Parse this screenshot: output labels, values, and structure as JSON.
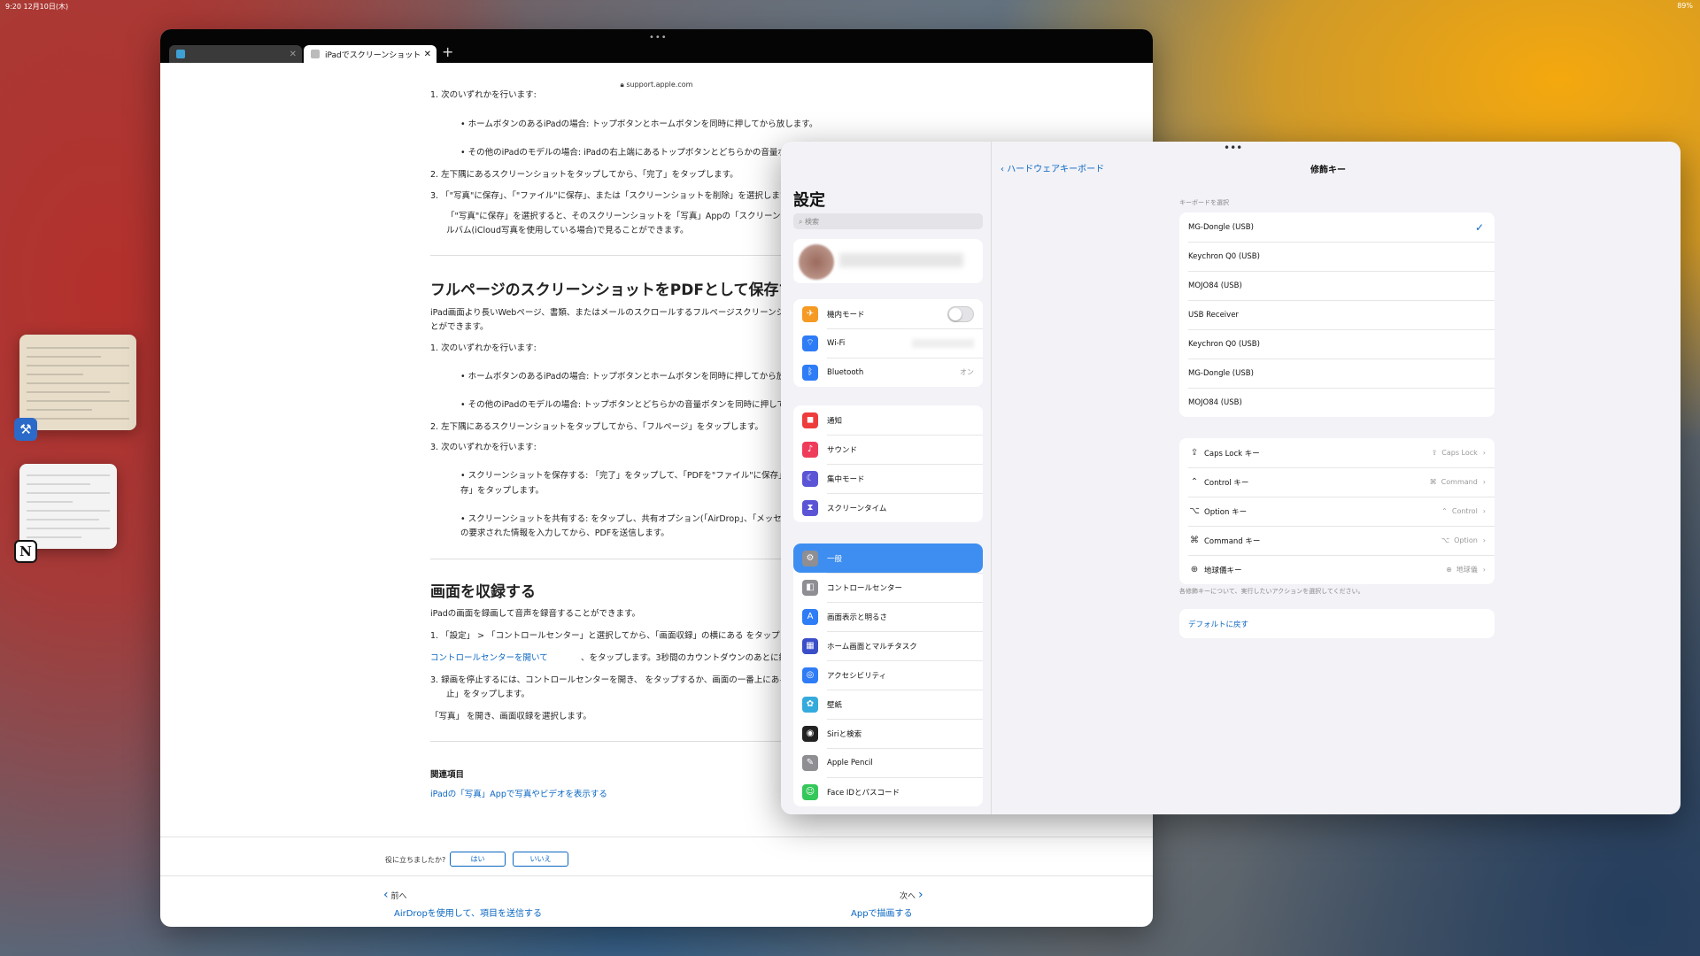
{
  "status": {
    "time": "9:20  12月10日(木)",
    "right": "89%"
  },
  "dock": {
    "app1": "xcode-icon",
    "app2": "N"
  },
  "safari": {
    "tabs": [
      {
        "label": "",
        "active": false
      },
      {
        "label": "iPadでスクリーンショット",
        "active": true
      }
    ],
    "url": "support.apple.com",
    "article": {
      "l1": "1. 次のいずれかを行います:",
      "l2": "• ホームボタンのあるiPadの場合: トップボタンとホームボタンを同時に押してから放します。",
      "l3": "• その他のiPadのモデルの場合: iPadの右上端にあるトップボタンとどちらかの音量ボタンを",
      "l4": "2. 左下隅にあるスクリーンショットをタップしてから、「完了」をタップします。",
      "l5": "3. 「\"写真\"に保存」、「\"ファイル\"に保存」、または「スクリーンショットを削除」を選択します。",
      "l6": "「\"写真\"に保存」を選択すると、そのスクリーンショットを「写真」Appの「スクリーンショット」アルバ",
      "l7": "ルバム(iCloud写真を使用している場合)で見ることができます。",
      "h1": "フルページのスクリーンショットをPDFとして保存する",
      "l8": "iPad画面より長いWebページ、書類、またはメールのスクロールするフルページスクリーンショットを",
      "l9": "とができます。",
      "l10": "1. 次のいずれかを行います:",
      "l11": "• ホームボタンのあるiPadの場合: トップボタンとホームボタンを同時に押してから放します。",
      "l12": "• その他のiPadのモデルの場合: トップボタンとどちらかの音量ボタンを同時に押してから放し",
      "l13": "2. 左下隅にあるスクリーンショットをタップしてから、「フルページ」をタップします。",
      "l14": "3. 次のいずれかを行います:",
      "l15": "• スクリーンショットを保存する: 「完了」をタップして、「PDFを\"ファイル\"に保存」を選択し、保",
      "l16": "存」をタップします。",
      "l17": "• スクリーンショットを共有する: をタップし、共有オプション(「AirDrop」、「メッセージ」、「メ",
      "l18": "の要求された情報を入力してから、PDFを送信します。",
      "h2": "画面を収録する",
      "l19": "iPadの画面を録画して音声を録音することができます。",
      "l20": "1. 「設定」 > 「コントロールセンター」と選択してから、「画面収録」の横にある をタップします。",
      "l21": "2. コントロールセンターを開いて、 をタップします。3秒間のカウントダウンのあとに録画が始まり",
      "l21link": "コントロールセンターを開いて",
      "l22": "3. 録画を停止するには、コントロールセンターを開き、 をタップするか、画面の一番上にある赤いス",
      "l23": "止」をタップします。",
      "l24": "「写真」 を開き、画面収録を選択します。",
      "related": "関連項目",
      "related_link": "iPadの「写真」Appで写真やビデオを表示する"
    },
    "feedback": {
      "question": "役に立ちましたか?",
      "yes": "はい",
      "no": "いいえ"
    },
    "nav": {
      "prev_label": "前へ",
      "prev_title": "AirDropを使用して、項目を送信する",
      "next_label": "次へ",
      "next_title": "Appで描画する"
    }
  },
  "settings": {
    "title": "設定",
    "search_placeholder": "検索",
    "group1": [
      {
        "label": "機内モード",
        "icon": "airplane-icon",
        "color": "#f59a23",
        "glyph": "✈"
      },
      {
        "label": "Wi-Fi",
        "icon": "wifi-icon",
        "color": "#2e7cf6",
        "glyph": "⌔"
      },
      {
        "label": "Bluetooth",
        "icon": "bluetooth-icon",
        "color": "#2e7cf6",
        "glyph": "ᛒ",
        "value": "オン"
      }
    ],
    "group2": [
      {
        "label": "通知",
        "icon": "notifications-icon",
        "color": "#ee3c3c",
        "glyph": "◼"
      },
      {
        "label": "サウンド",
        "icon": "sound-icon",
        "color": "#ee3c5a",
        "glyph": "♪"
      },
      {
        "label": "集中モード",
        "icon": "focus-icon",
        "color": "#5b55d6",
        "glyph": "☾"
      },
      {
        "label": "スクリーンタイム",
        "icon": "screentime-icon",
        "color": "#5b55d6",
        "glyph": "⧗"
      }
    ],
    "group3": [
      {
        "label": "一般",
        "icon": "gear-icon",
        "color": "#8e8e93",
        "glyph": "⚙",
        "selected": true
      },
      {
        "label": "コントロールセンター",
        "icon": "control-center-icon",
        "color": "#8e8e93",
        "glyph": "◧"
      },
      {
        "label": "画面表示と明るさ",
        "icon": "display-icon",
        "color": "#2e7cf6",
        "glyph": "A"
      },
      {
        "label": "ホーム画面とマルチタスク",
        "icon": "home-screen-icon",
        "color": "#3a4ec9",
        "glyph": "▦"
      },
      {
        "label": "アクセシビリティ",
        "icon": "accessibility-icon",
        "color": "#2e7cf6",
        "glyph": "◎"
      },
      {
        "label": "壁紙",
        "icon": "wallpaper-icon",
        "color": "#35aadc",
        "glyph": "✿"
      },
      {
        "label": "Siriと検索",
        "icon": "siri-icon",
        "color": "#222",
        "glyph": "◉"
      },
      {
        "label": "Apple Pencil",
        "icon": "pencil-icon",
        "color": "#8e8e93",
        "glyph": "✎"
      },
      {
        "label": "Face IDとパスコード",
        "icon": "faceid-icon",
        "color": "#34c759",
        "glyph": "☺"
      }
    ],
    "detail": {
      "back_label": "ハードウェアキーボード",
      "title": "修飾キー",
      "section_label": "キーボードを選択",
      "keyboards": [
        {
          "label": "MG-Dongle (USB)",
          "checked": true
        },
        {
          "label": "Keychron Q0 (USB)"
        },
        {
          "label": "MOJO84 (USB)"
        },
        {
          "label": "USB Receiver"
        },
        {
          "label": "Keychron Q0 (USB)"
        },
        {
          "label": "MG-Dongle (USB)"
        },
        {
          "label": "MOJO84 (USB)"
        }
      ],
      "modifiers": [
        {
          "label": "Caps Lock キー",
          "glyph": "⇪",
          "icon": "capslock-icon",
          "value": "Caps Lock",
          "value_glyph": "⇪"
        },
        {
          "label": "Control キー",
          "glyph": "⌃",
          "icon": "control-icon",
          "value": "Command",
          "value_glyph": "⌘"
        },
        {
          "label": "Option キー",
          "glyph": "⌥",
          "icon": "option-icon",
          "value": "Control",
          "value_glyph": "⌃"
        },
        {
          "label": "Command キー",
          "glyph": "⌘",
          "icon": "command-icon",
          "value": "Option",
          "value_glyph": "⌥"
        },
        {
          "label": "地球儀キー",
          "glyph": "⊕",
          "icon": "globe-icon",
          "value": "地球儀",
          "value_glyph": "⊕"
        }
      ],
      "note": "各修飾キーについて、実行したいアクションを選択してください。",
      "reset": "デフォルトに戻す"
    }
  }
}
